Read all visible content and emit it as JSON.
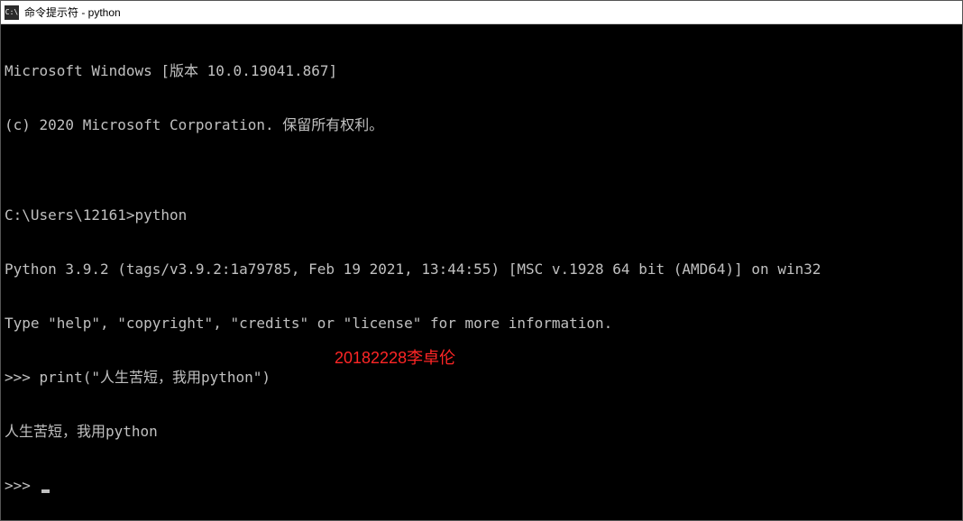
{
  "titlebar": {
    "icon_label": "C:\\",
    "title": "命令提示符 - python"
  },
  "console": {
    "lines": [
      "Microsoft Windows [版本 10.0.19041.867]",
      "(c) 2020 Microsoft Corporation. 保留所有权利。",
      "",
      "C:\\Users\\12161>python",
      "Python 3.9.2 (tags/v3.9.2:1a79785, Feb 19 2021, 13:44:55) [MSC v.1928 64 bit (AMD64)] on win32",
      "Type \"help\", \"copyright\", \"credits\" or \"license\" for more information.",
      ">>> print(\"人生苦短，我用python\")",
      "人生苦短，我用python",
      ">>> "
    ]
  },
  "watermark": {
    "text": "20182228李卓伦"
  }
}
